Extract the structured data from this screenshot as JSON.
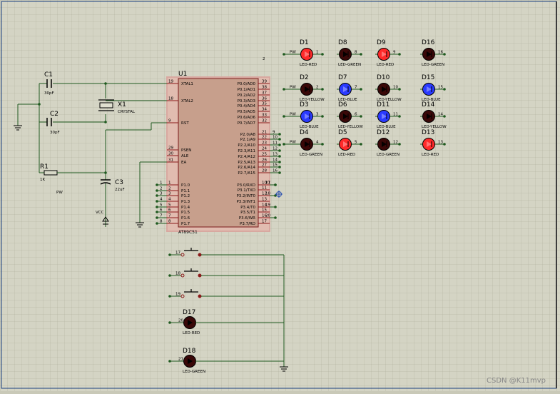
{
  "mcu": {
    "ref": "U1",
    "part": "AT89C51",
    "left_pins": [
      {
        "num": "19",
        "name": "XTAL1"
      },
      {
        "num": "18",
        "name": "XTAL2"
      },
      {
        "num": "9",
        "name": "RST"
      },
      {
        "num": "29",
        "name": "PSEN"
      },
      {
        "num": "30",
        "name": "ALE"
      },
      {
        "num": "31",
        "name": "EA"
      },
      {
        "num": "1",
        "name": "P1.0"
      },
      {
        "num": "2",
        "name": "P1.1"
      },
      {
        "num": "3",
        "name": "P1.2"
      },
      {
        "num": "4",
        "name": "P1.3"
      },
      {
        "num": "5",
        "name": "P1.4"
      },
      {
        "num": "6",
        "name": "P1.5"
      },
      {
        "num": "7",
        "name": "P1.6"
      },
      {
        "num": "8",
        "name": "P1.7"
      }
    ],
    "right_pins": [
      {
        "num": "39",
        "name": "P0.0/AD0"
      },
      {
        "num": "38",
        "name": "P0.1/AD1"
      },
      {
        "num": "37",
        "name": "P0.2/AD2"
      },
      {
        "num": "36",
        "name": "P0.3/AD3"
      },
      {
        "num": "35",
        "name": "P0.4/AD4"
      },
      {
        "num": "34",
        "name": "P0.5/AD5"
      },
      {
        "num": "33",
        "name": "P0.6/AD6"
      },
      {
        "num": "32",
        "name": "P0.7/AD7"
      },
      {
        "num": "21",
        "name": "P2.0/A8"
      },
      {
        "num": "22",
        "name": "P2.1/A9"
      },
      {
        "num": "23",
        "name": "P2.2/A10"
      },
      {
        "num": "24",
        "name": "P2.3/A11"
      },
      {
        "num": "25",
        "name": "P2.4/A12"
      },
      {
        "num": "26",
        "name": "P2.5/A13"
      },
      {
        "num": "27",
        "name": "P2.6/A14"
      },
      {
        "num": "28",
        "name": "P2.7/A15"
      },
      {
        "num": "10",
        "name": "P3.0/RXD"
      },
      {
        "num": "11",
        "name": "P3.1/TXD"
      },
      {
        "num": "12",
        "name": "P3.2/INT0"
      },
      {
        "num": "13",
        "name": "P3.3/INT1"
      },
      {
        "num": "14",
        "name": "P3.4/T0"
      },
      {
        "num": "15",
        "name": "P3.5/T1"
      },
      {
        "num": "16",
        "name": "P3.6/WR"
      },
      {
        "num": "17",
        "name": "P3.7/RD"
      }
    ],
    "p2_net_labels": [
      "9",
      "10",
      "11",
      "12",
      "13",
      "14",
      "15",
      "16"
    ],
    "p3_net_labels": [
      "17",
      "18",
      "19",
      "20",
      "21"
    ],
    "p1_net_labels": [
      "1",
      "2",
      "3",
      "4",
      "5",
      "6",
      "7",
      "8"
    ]
  },
  "components": {
    "c1": {
      "ref": "C1",
      "value": "30pF"
    },
    "c2": {
      "ref": "C2",
      "value": "30pF"
    },
    "x1": {
      "ref": "X1",
      "value": "CRYSTAL"
    },
    "r1": {
      "ref": "R1",
      "value": "1K"
    },
    "c3": {
      "ref": "C3",
      "value": "22uF"
    }
  },
  "labels": {
    "pw": "PW",
    "vcc": "VCC",
    "net2": "2"
  },
  "led_rows": [
    [
      {
        "ref": "D1",
        "label": "LED-RED",
        "pin": "1",
        "color": "#ff2a2a",
        "lit": true
      },
      {
        "ref": "D8",
        "label": "LED-GREEN",
        "pin": "8",
        "color": "#3a0808",
        "lit": false
      },
      {
        "ref": "D9",
        "label": "LED-RED",
        "pin": "9",
        "color": "#ff2a2a",
        "lit": true
      },
      {
        "ref": "D16",
        "label": "LED-GREEN",
        "pin": "16",
        "color": "#3a0808",
        "lit": false
      }
    ],
    [
      {
        "ref": "D2",
        "label": "LED-YELLOW",
        "pin": "2",
        "color": "#3a0808",
        "lit": false
      },
      {
        "ref": "D7",
        "label": "LED-BLUE",
        "pin": "7",
        "color": "#2a3aff",
        "lit": true
      },
      {
        "ref": "D10",
        "label": "LED-YELLOW",
        "pin": "10",
        "color": "#3a0808",
        "lit": false
      },
      {
        "ref": "D15",
        "label": "LED-BLUE",
        "pin": "15",
        "color": "#2a3aff",
        "lit": true
      }
    ],
    [
      {
        "ref": "D3",
        "label": "LED-BLUE",
        "pin": "3",
        "color": "#2a3aff",
        "lit": true
      },
      {
        "ref": "D6",
        "label": "LED-YELLOW",
        "pin": "6",
        "color": "#3a0808",
        "lit": false
      },
      {
        "ref": "D11",
        "label": "LED-BLUE",
        "pin": "11",
        "color": "#2a3aff",
        "lit": true
      },
      {
        "ref": "D14",
        "label": "LED-YELLOW",
        "pin": "14",
        "color": "#3a0808",
        "lit": false
      }
    ],
    [
      {
        "ref": "D4",
        "label": "LED-GREEN",
        "pin": "4",
        "color": "#3a0808",
        "lit": false
      },
      {
        "ref": "D5",
        "label": "LED-RED",
        "pin": "5",
        "color": "#ff2a2a",
        "lit": true
      },
      {
        "ref": "D12",
        "label": "LED-GREEN",
        "pin": "12",
        "color": "#3a0808",
        "lit": false
      },
      {
        "ref": "D13",
        "label": "LED-RED",
        "pin": "13",
        "color": "#ff2a2a",
        "lit": true
      }
    ]
  ],
  "led_row_power_label": "PW",
  "switches": [
    {
      "pin": "17"
    },
    {
      "pin": "18"
    },
    {
      "pin": "19"
    }
  ],
  "bottom_leds": [
    {
      "ref": "D17",
      "label": "LED-RED",
      "pin": "20",
      "color": "#3a0808"
    },
    {
      "ref": "D18",
      "label": "LED-GREEN",
      "pin": "21",
      "color": "#3a0808"
    }
  ],
  "watermark": "CSDN @K11mvp"
}
